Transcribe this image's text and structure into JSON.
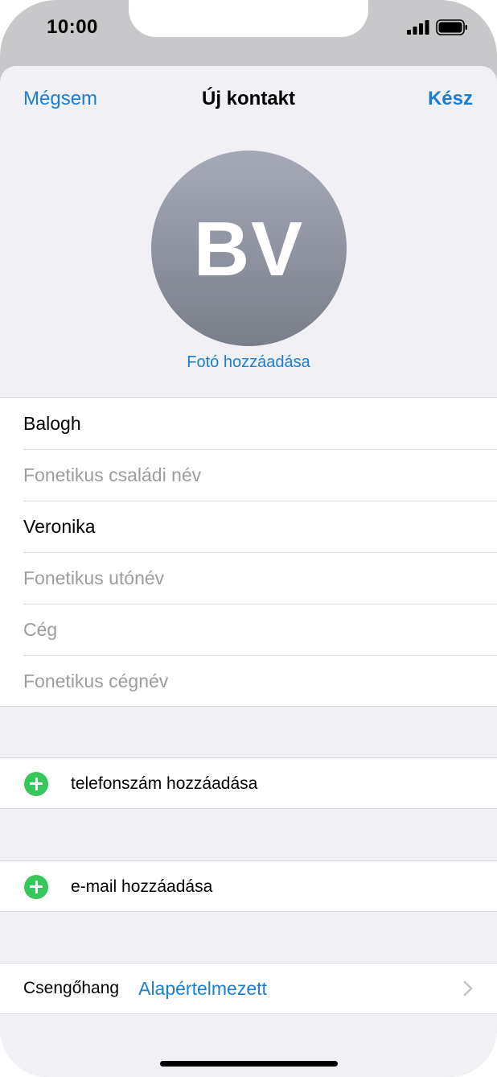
{
  "status_bar": {
    "time": "10:00"
  },
  "nav": {
    "cancel_label": "Mégsem",
    "title": "Új kontakt",
    "done_label": "Kész"
  },
  "avatar": {
    "initials": "BV",
    "add_photo_label": "Fotó hozzáadása"
  },
  "name_fields": [
    {
      "value": "Balogh",
      "placeholder": ""
    },
    {
      "value": "",
      "placeholder": "Fonetikus családi név"
    },
    {
      "value": "Veronika",
      "placeholder": ""
    },
    {
      "value": "",
      "placeholder": "Fonetikus utónév"
    },
    {
      "value": "",
      "placeholder": "Cég"
    },
    {
      "value": "",
      "placeholder": "Fonetikus cégnév"
    }
  ],
  "actions": {
    "add_phone_label": "telefonszám hozzáadása",
    "add_email_label": "e-mail hozzáadása"
  },
  "ringtone": {
    "label": "Csengőhang",
    "value": "Alapértelmezett"
  },
  "colors": {
    "accent": "#1a7fd4",
    "add_icon": "#34c759",
    "placeholder_text": "#9c9ca0",
    "background": "#f1f1f5"
  },
  "icons": [
    "signal-icon",
    "battery-icon",
    "plus-circle-icon",
    "chevron-right-icon"
  ]
}
